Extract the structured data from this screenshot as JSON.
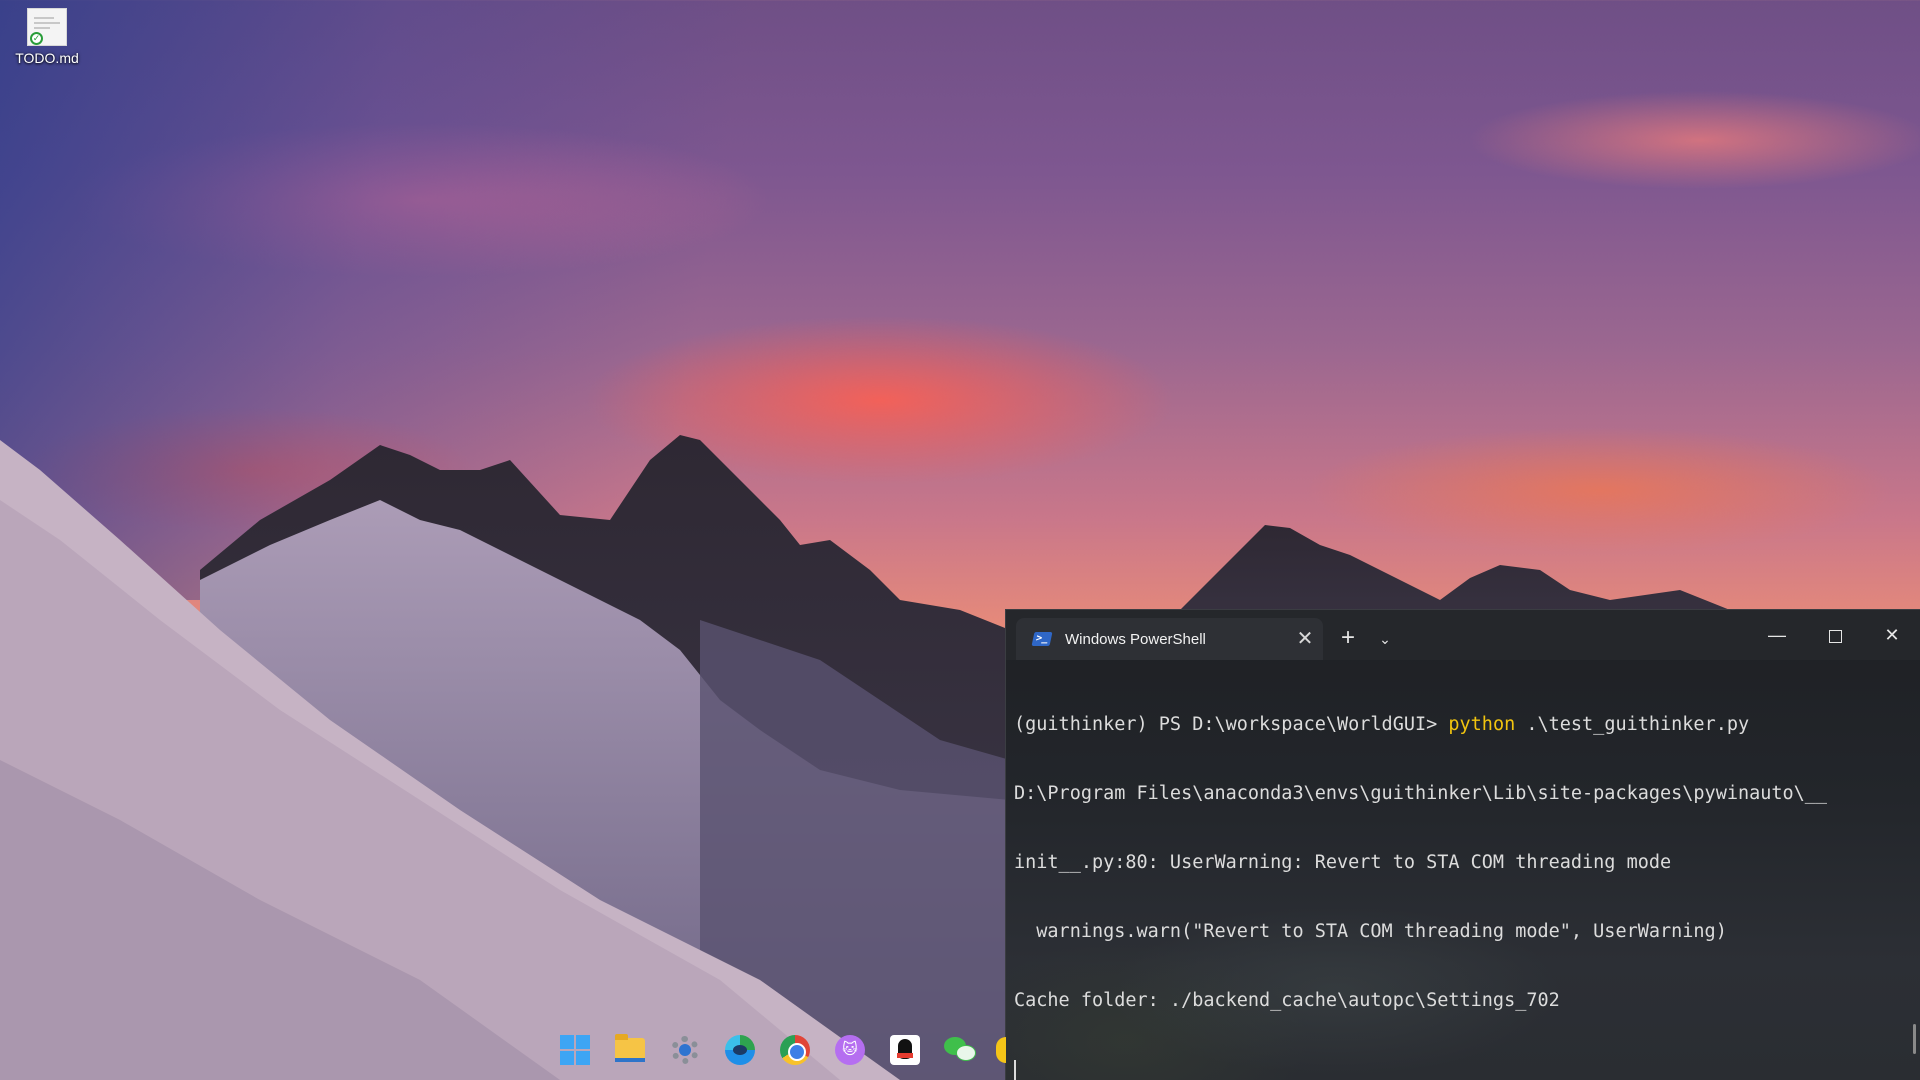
{
  "desktop": {
    "icons": [
      {
        "label": "TODO.md",
        "icon": "markdown-file-icon"
      }
    ]
  },
  "terminal": {
    "tab_title": "Windows PowerShell",
    "tab_icon": "powershell-icon",
    "new_tab_label": "+",
    "dropdown_label": "⌄",
    "min_label": "—",
    "close_label": "✕",
    "tab_close_label": "✕",
    "lines": {
      "prompt": "(guithinker) PS D:\\workspace\\WorldGUI> ",
      "cmd_keyword": "python",
      "cmd_args": " .\\test_guithinker.py",
      "l2": "D:\\Program Files\\anaconda3\\envs\\guithinker\\Lib\\site-packages\\pywinauto\\__",
      "l3": "init__.py:80: UserWarning: Revert to STA COM threading mode",
      "l4": "  warnings.warn(\"Revert to STA COM threading mode\", UserWarning)",
      "l5": "Cache folder: ./backend_cache\\autopc\\Settings_702"
    },
    "colors": {
      "background": "#23262b",
      "text": "#dcdcdc",
      "command_highlight": "#f1c40f"
    }
  },
  "taskbar": {
    "items": [
      {
        "icon": "windows-start-icon"
      },
      {
        "icon": "file-explorer-icon"
      },
      {
        "icon": "settings-gear-icon"
      },
      {
        "icon": "edge-browser-icon"
      },
      {
        "icon": "chrome-browser-icon"
      },
      {
        "icon": "cat-app-icon"
      },
      {
        "icon": "qq-penguin-icon"
      },
      {
        "icon": "wechat-icon"
      },
      {
        "icon": "partial-app-icon"
      }
    ]
  }
}
